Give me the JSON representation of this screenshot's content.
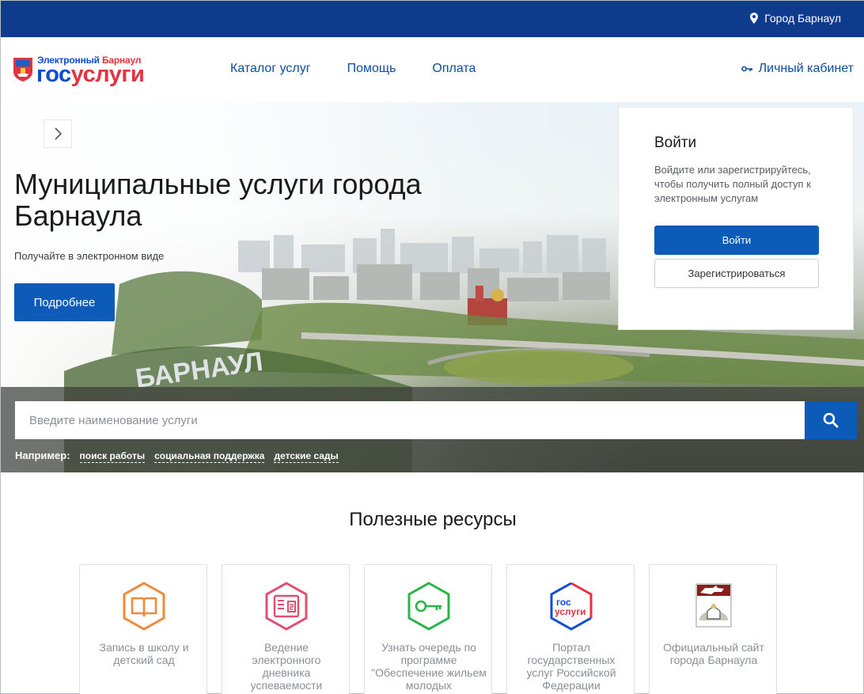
{
  "topbar": {
    "city": "Город Барнаул"
  },
  "logo": {
    "subtitle_prefix": "Электронный",
    "subtitle_city": "Барнаул",
    "brand_a": "гос",
    "brand_b": "услуги"
  },
  "nav": [
    {
      "label": "Каталог услуг"
    },
    {
      "label": "Помощь"
    },
    {
      "label": "Оплата"
    }
  ],
  "cabinet_label": "Личный кабинет",
  "hero": {
    "title": "Муниципальные услуги города Барнаула",
    "subtitle": "Получайте в электронном виде",
    "more_label": "Подробнее",
    "sign_text": "БАРНАУЛ"
  },
  "login": {
    "title": "Войти",
    "description": "Войдите или зарегистрируйтесь, чтобы получить полный доступ к электронным услугам",
    "login_label": "Войти",
    "register_label": "Зарегистрироваться"
  },
  "search": {
    "placeholder": "Введите наименование услуги",
    "examples_label": "Например:",
    "examples": [
      "поиск работы",
      "социальная поддержка",
      "детские сады"
    ]
  },
  "resources": {
    "title": "Полезные ресурсы",
    "cards": [
      {
        "label": "Запись в школу и детский сад",
        "icon": "book-icon",
        "color": "#f08a3a"
      },
      {
        "label": "Ведение электронного дневника успеваемости",
        "icon": "diary-icon",
        "color": "#e0506e"
      },
      {
        "label": "Узнать очередь по программе \"Обеспечение жильем молодых",
        "icon": "key-icon",
        "color": "#2ab54a"
      },
      {
        "label": "Портал государственных услуг Российской Федерации",
        "icon": "gosuslugi-logo-icon",
        "logo_a": "гос",
        "logo_b": "услуги"
      },
      {
        "label": "Официальный сайт города Барнаула",
        "icon": "barnaul-coat-of-arms-icon"
      }
    ]
  },
  "colors": {
    "primary": "#0d5bb8",
    "topbar": "#0f3b8c",
    "brand_red": "#e2343f"
  }
}
